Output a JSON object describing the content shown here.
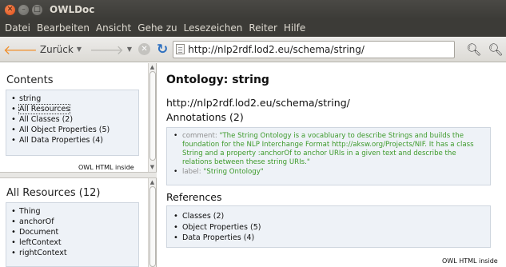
{
  "window": {
    "title": "OWLDoc"
  },
  "menu": [
    "Datei",
    "Bearbeiten",
    "Ansicht",
    "Gehe zu",
    "Lesezeichen",
    "Reiter",
    "Hilfe"
  ],
  "nav": {
    "back_label": "Zurück",
    "url": "http://nlp2rdf.lod2.eu/schema/string/"
  },
  "contents": {
    "heading": "Contents",
    "items": [
      "string",
      "All Resources",
      "All Classes (2)",
      "All Object Properties (5)",
      "All Data Properties (4)"
    ],
    "footer": "OWL HTML inside"
  },
  "resources": {
    "heading": "All Resources (12)",
    "items": [
      "Thing",
      "anchorOf",
      "Document",
      "leftContext",
      "rightContext"
    ]
  },
  "main": {
    "title": "Ontology: string",
    "iri": "http://nlp2rdf.lod2.eu/schema/string/",
    "annotations_heading": "Annotations (2)",
    "annotations": [
      {
        "key": "comment:",
        "value": "\"The String Ontology is a vocabluary to describe Strings and builds the foundation for the NLP Interchange Format http://aksw.org/Projects/NIF. It has a class String and a property :anchorOf to anchor URIs in a given text and describe the relations between these string URIs.\""
      },
      {
        "key": "label:",
        "value": "\"String Ontology\""
      }
    ],
    "references_heading": "References",
    "references": [
      "Classes (2)",
      "Object Properties (5)",
      "Data Properties (4)"
    ],
    "footer": "OWL HTML inside"
  }
}
